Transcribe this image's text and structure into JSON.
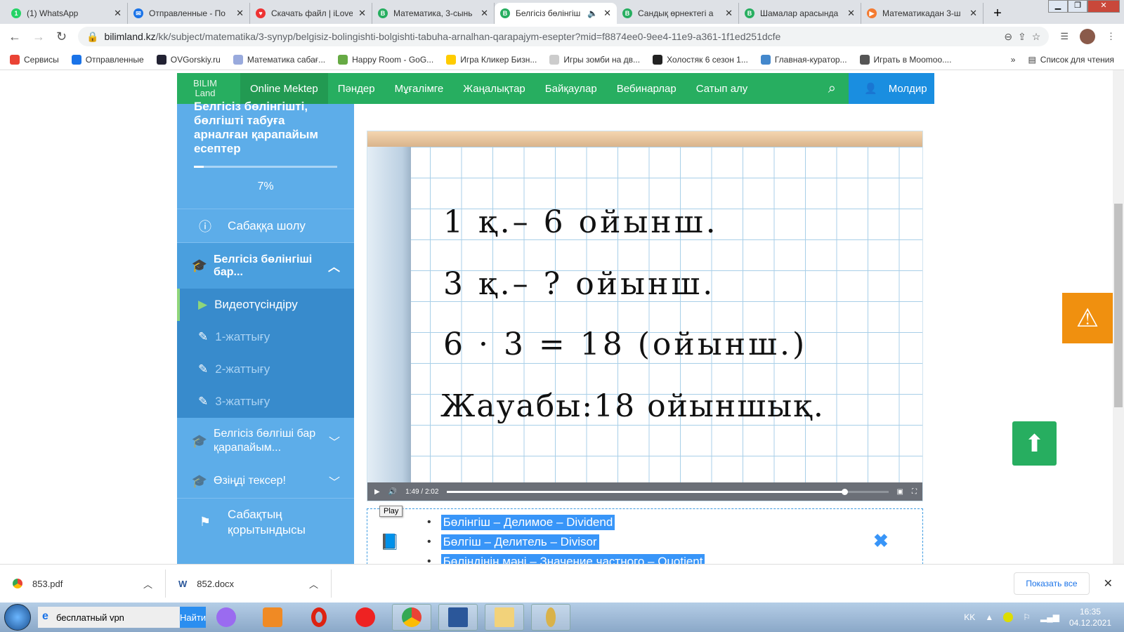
{
  "browser": {
    "tabs": [
      {
        "title": "(1) WhatsApp",
        "color": "#25d366",
        "glyph": "1"
      },
      {
        "title": "Отправленные - По",
        "color": "#1a73e8",
        "glyph": "✉"
      },
      {
        "title": "Скачать файл | iLove",
        "color": "#e33",
        "glyph": "♥"
      },
      {
        "title": "Математика, 3-сынь",
        "color": "#27ae60",
        "glyph": "B"
      },
      {
        "title": "Белгісіз бөлінгіш",
        "color": "#27ae60",
        "glyph": "B",
        "active": true,
        "audio": "🔈"
      },
      {
        "title": "Сандық өрнектегі а",
        "color": "#27ae60",
        "glyph": "B"
      },
      {
        "title": "Шамалар арасында",
        "color": "#27ae60",
        "glyph": "B"
      },
      {
        "title": "Математикадан 3-ш",
        "color": "#f47b31",
        "glyph": "▶"
      }
    ],
    "url_domain": "bilimland.kz",
    "url_rest": "/kk/subject/matematika/3-synyp/belgisiz-bolingishti-bolgishti-tabuha-arnalhan-qarapajym-esepter?mid=f8874ee0-9ee4-11e9-a361-1f1ed251dcfe",
    "bookmarks": [
      {
        "label": "Сервисы",
        "color": "#ea4335"
      },
      {
        "label": "Отправленные",
        "color": "#1a73e8"
      },
      {
        "label": "OVGorskiy.ru",
        "color": "#223"
      },
      {
        "label": "Математика сабағ...",
        "color": "#9ad"
      },
      {
        "label": "Happy Room - GoG...",
        "color": "#6a4"
      },
      {
        "label": "Игра Кликер Бизн...",
        "color": "#fc0"
      },
      {
        "label": "Игры зомби на дв...",
        "color": "#ccc"
      },
      {
        "label": "Холостяк 6 сезон 1...",
        "color": "#222"
      },
      {
        "label": "Главная-куратор...",
        "color": "#48c"
      },
      {
        "label": "Играть в Moomoo....",
        "color": "#555"
      }
    ],
    "reading_list": "Список для чтения"
  },
  "site": {
    "logo": [
      "BILIM",
      "Land"
    ],
    "nav": [
      "Online Mektep",
      "Пәндер",
      "Мұғалімге",
      "Жаңалықтар",
      "Байқаулар",
      "Вебинарлар",
      "Сатып алу"
    ],
    "user": "Молдир"
  },
  "sidebar": {
    "title": "Белгісіз бөлінгішті, бөлгішті табуға арналған қарапайым есептер",
    "progress_label": "7%",
    "progress": 7,
    "overview": "Сабаққа шолу",
    "section1": "Белгісіз бөлінгіші бар...",
    "sub": [
      "Видеотүсіндіру",
      "1-жаттығу",
      "2-жаттығу",
      "3-жаттығу"
    ],
    "section2": "Белгісіз бөлгіші бар қарапайым...",
    "section3": "Өзіңді тексер!",
    "summary": "Сабақтың қорытындысы"
  },
  "video": {
    "lines": [
      "1 қ.– 6 ойынш.",
      "3 қ.– ? ойынш.",
      "6 · 3 = 18 (ойынш.)",
      "Жауабы:18 ойыншық."
    ],
    "current": "1:49",
    "duration": "2:02",
    "progress": 0.9,
    "tooltip": "Play"
  },
  "glossary": [
    "Бөлінгіш – Делимое – Dividend",
    "Бөлгіш – Делитель – Divisor",
    "Бөліндінің мәні – Значение частного – Quotient"
  ],
  "downloads": {
    "items": [
      "853.pdf",
      "852.docx"
    ],
    "show_all": "Показать все"
  },
  "taskbar": {
    "search_value": "бесплатный vpn",
    "search_button": "Найти",
    "lang": "KK",
    "time": "16:35",
    "date": "04.12.2021"
  }
}
